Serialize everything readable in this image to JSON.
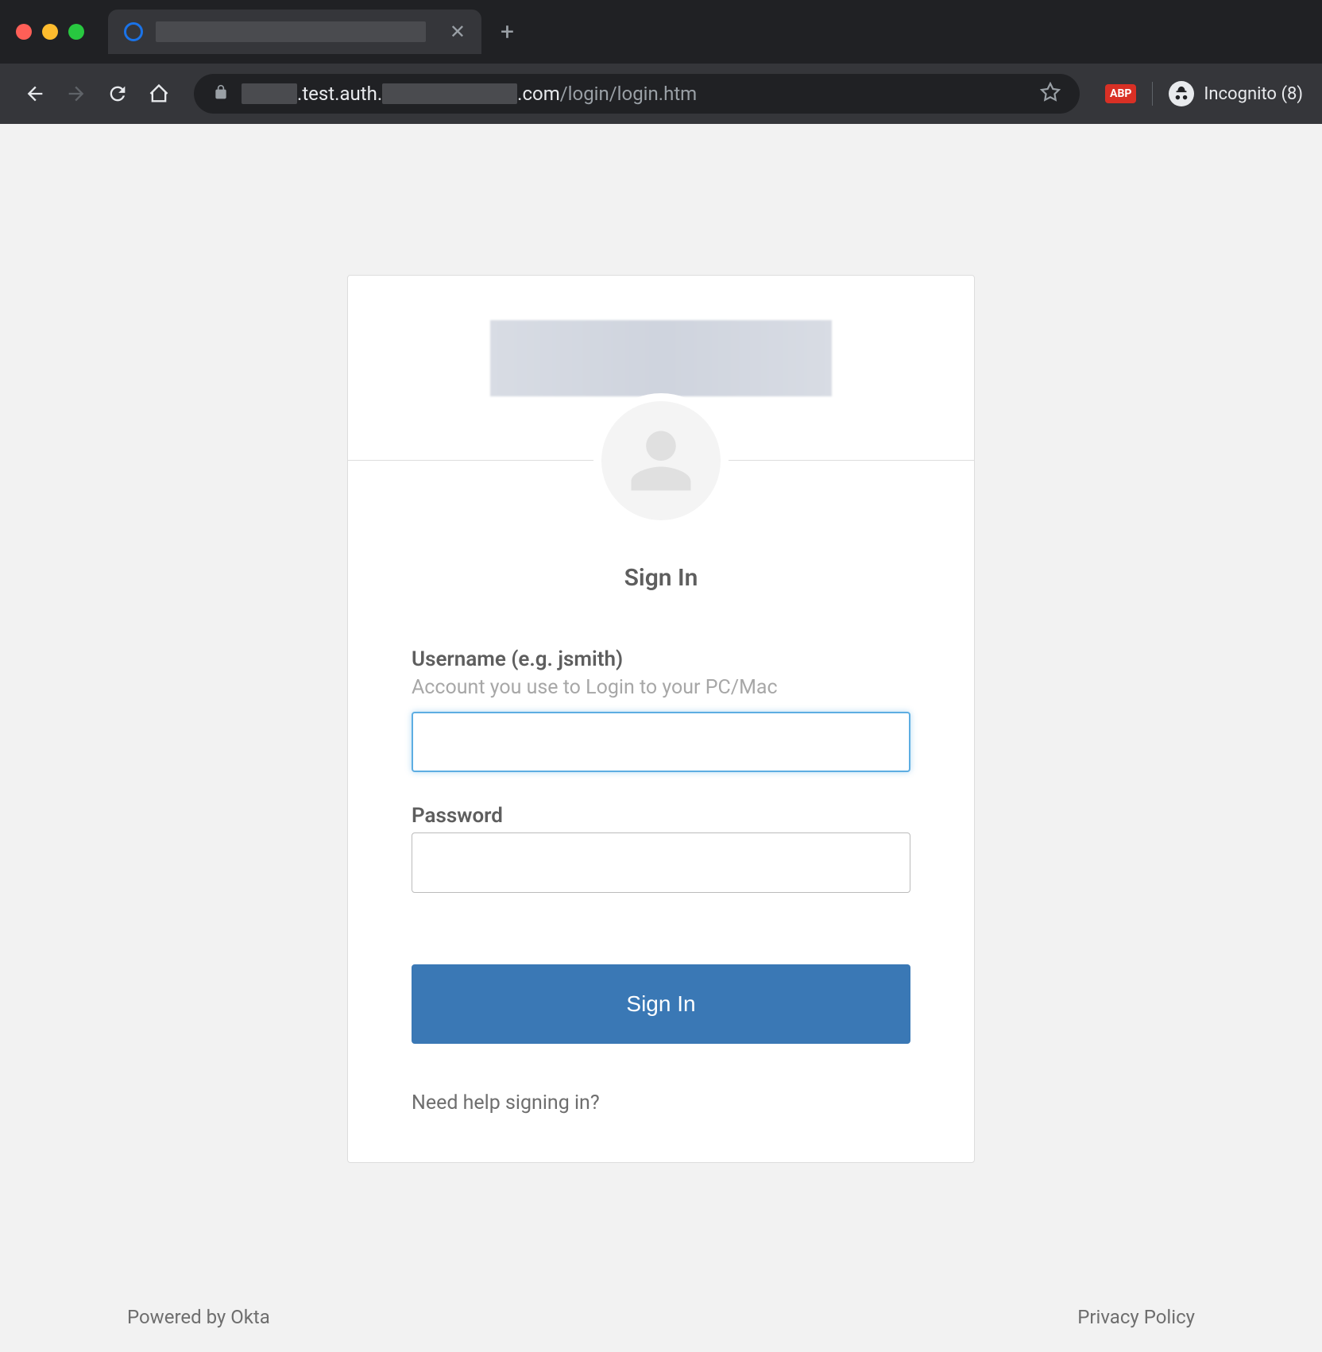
{
  "browser": {
    "url_visible_part1": ".test.auth.",
    "url_visible_part2": ".com",
    "url_path": "/login/login.htm",
    "incognito_label": "Incognito (8)",
    "ext_badge": "ABP"
  },
  "login": {
    "heading": "Sign In",
    "username_label": "Username (e.g. jsmith)",
    "username_hint": "Account you use to Login to your PC/Mac",
    "username_value": "",
    "password_label": "Password",
    "password_value": "",
    "submit_label": "Sign In",
    "help_link": "Need help signing in?"
  },
  "footer": {
    "powered_by": "Powered by Okta",
    "privacy_link": "Privacy Policy"
  }
}
